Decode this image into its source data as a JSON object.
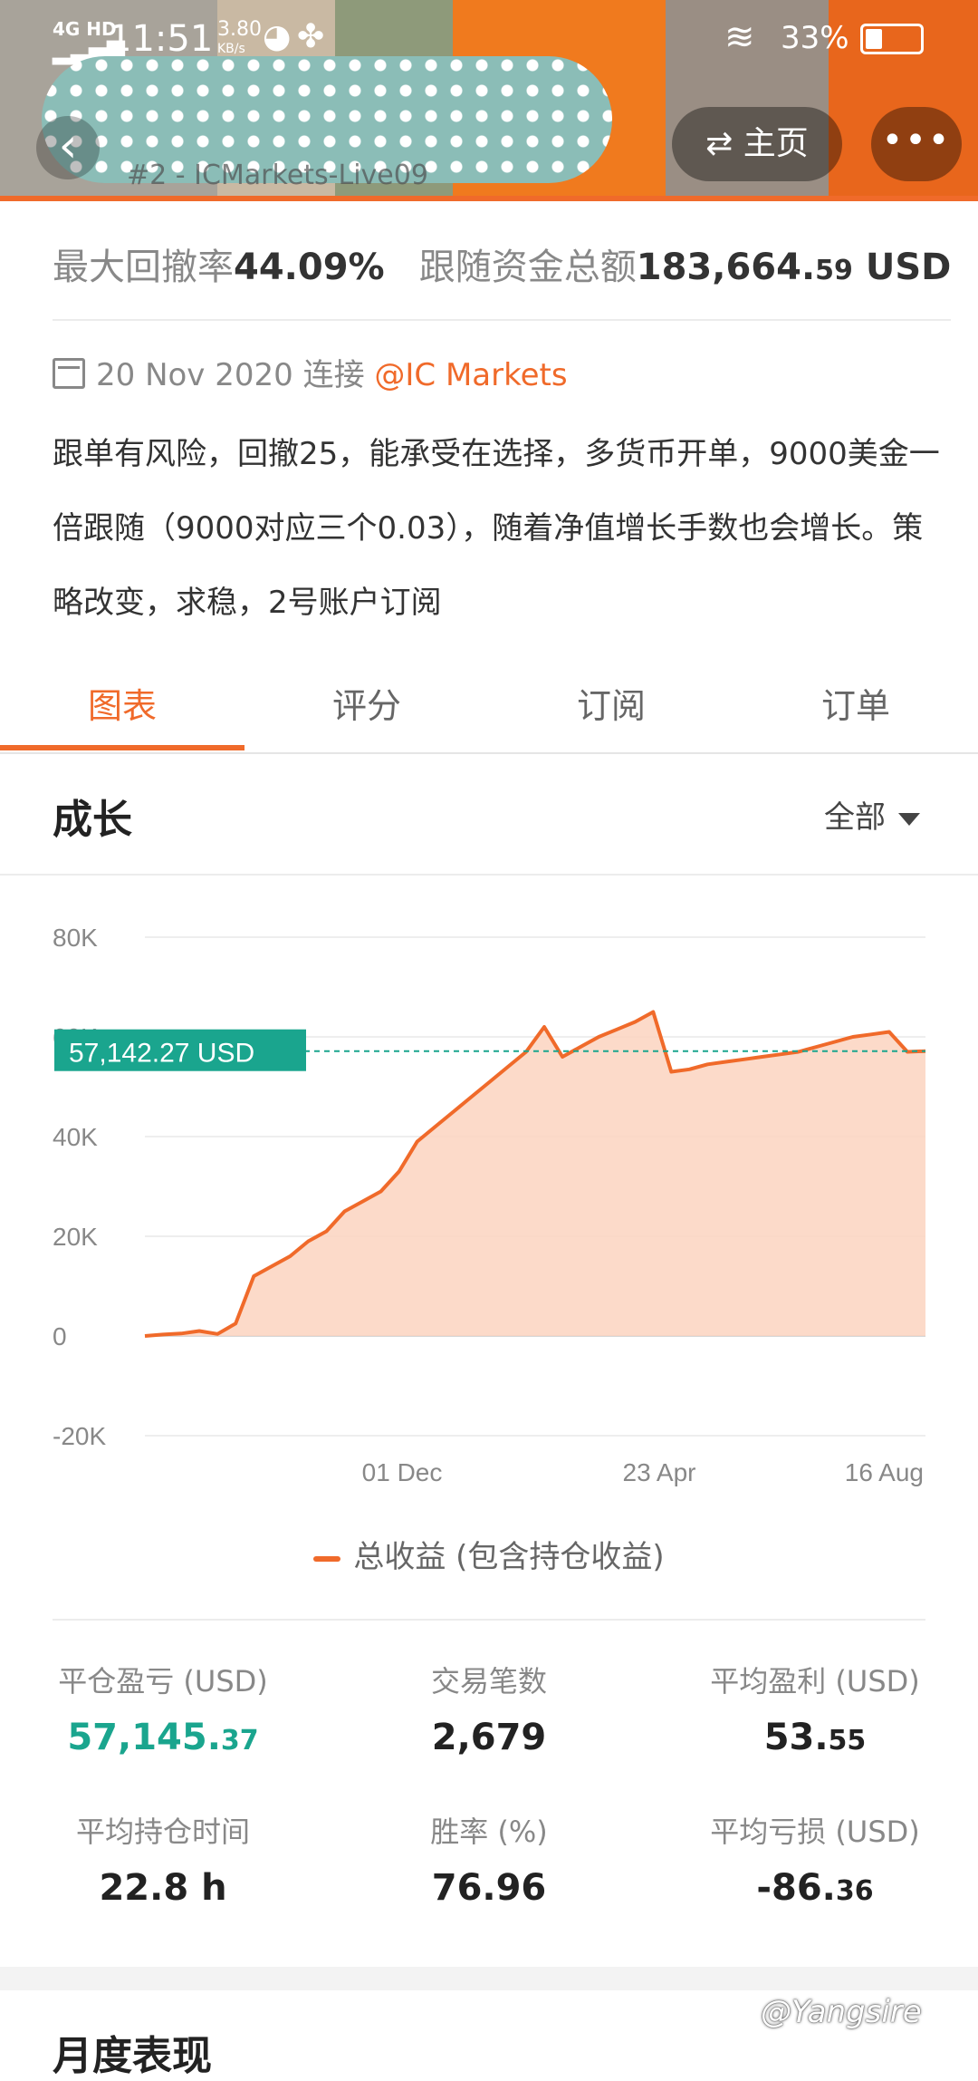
{
  "status_bar": {
    "network": "4G HD",
    "time": "11:51",
    "speed": "3.80",
    "speed_unit": "KB/s",
    "battery": "33%"
  },
  "header": {
    "back_label": "‹",
    "home_label": "⇄ 主页",
    "more_label": "•••",
    "title_fragment": "#2 - ICMarkets-Live09"
  },
  "stats": {
    "max_drawdown_label": "最大回撤率",
    "max_drawdown_value": "44.09%",
    "follow_funds_label": "跟随资金总额",
    "follow_funds_value_main": "183,664.",
    "follow_funds_value_dec": "59",
    "follow_funds_unit": "USD"
  },
  "account": {
    "date": "20 Nov 2020",
    "connect_label": "连接",
    "broker": "@IC Markets",
    "description": "跟单有风险，回撤25，能承受在选择，多货币开单，9000美金一倍跟随（9000对应三个0.03），随着净值增长手数也会增长。策略改变，求稳，2号账户订阅"
  },
  "tabs": [
    {
      "label": "图表",
      "active": true
    },
    {
      "label": "评分",
      "active": false
    },
    {
      "label": "订阅",
      "active": false
    },
    {
      "label": "订单",
      "active": false
    }
  ],
  "growth": {
    "title": "成长",
    "scope": "全部"
  },
  "chart_data": {
    "type": "area",
    "y_ticks": [
      "80K",
      "60K",
      "40K",
      "20K",
      "0",
      "-20K"
    ],
    "ylim": [
      -20000,
      80000
    ],
    "x_tick_labels": [
      "01 Dec",
      "23 Apr",
      "16 Aug"
    ],
    "current_value_label": "57,142.27 USD",
    "current_value": 57142.27,
    "series": [
      {
        "name": "总收益 (包含持仓收益)",
        "values": [
          0,
          300,
          500,
          1000,
          400,
          2500,
          12000,
          14000,
          16000,
          19000,
          21000,
          25000,
          27000,
          29000,
          33000,
          39000,
          42000,
          45000,
          48000,
          51000,
          54000,
          57000,
          62000,
          56000,
          58000,
          60000,
          61500,
          63000,
          65000,
          53000,
          53500,
          54500,
          55000,
          55500,
          56000,
          56500,
          57000,
          58000,
          59000,
          60000,
          60500,
          61000,
          57000,
          57142
        ]
      }
    ],
    "color": "#f06a2a",
    "fill": "#fcd3c0",
    "marker_color": "#1aa58e"
  },
  "metrics": [
    {
      "label": "平仓盈亏 (USD)",
      "main": "57,145.",
      "dec": "37",
      "green": true
    },
    {
      "label": "交易笔数",
      "main": "2,679",
      "dec": "",
      "green": false
    },
    {
      "label": "平均盈利 (USD)",
      "main": "53.",
      "dec": "55",
      "green": false
    },
    {
      "label": "平均持仓时间",
      "main": "22.8 h",
      "dec": "",
      "green": false
    },
    {
      "label": "胜率 (%)",
      "main": "76.96",
      "dec": "",
      "green": false
    },
    {
      "label": "平均亏损 (USD)",
      "main": "-86.",
      "dec": "36",
      "green": false
    }
  ],
  "monthly": {
    "title": "月度表现"
  },
  "watermark": "@Yangsire"
}
